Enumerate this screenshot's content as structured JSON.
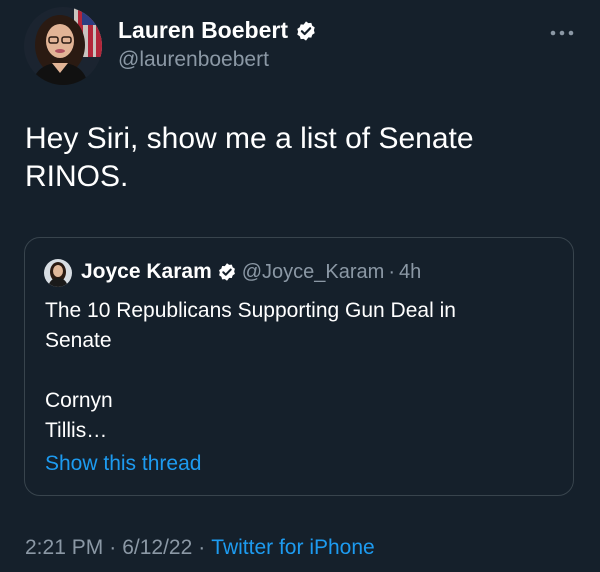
{
  "author": {
    "name": "Lauren Boebert",
    "handle": "@laurenboebert",
    "verified": true
  },
  "tweet": {
    "text": "Hey Siri, show me a list of Senate\nRINOS."
  },
  "quoted_tweet": {
    "name": "Joyce Karam",
    "handle": "@Joyce_Karam",
    "separator": "·",
    "time": "4h",
    "text": "The 10 Republicans Supporting Gun Deal in\nSenate\n\nCornyn\nTillis…",
    "show_thread_label": "Show this thread"
  },
  "footer": {
    "time": "2:21 PM",
    "sep1": "·",
    "date": "6/12/22",
    "sep2": "·",
    "source": "Twitter for iPhone"
  },
  "colors": {
    "background": "#15202b",
    "link": "#1d9bf0",
    "muted": "#8b98a5",
    "border": "#38444d"
  },
  "icons": {
    "more": "more-horizontal-icon",
    "verified": "verified-badge-icon"
  }
}
